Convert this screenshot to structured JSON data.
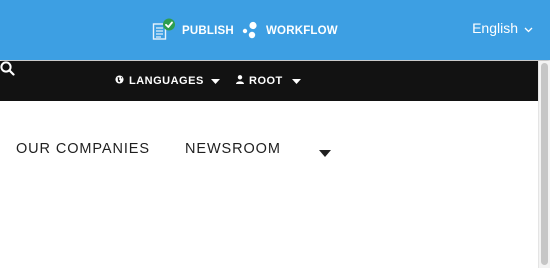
{
  "topbar": {
    "publish_label": "PUBLISH",
    "workflow_label": "WORKFLOW",
    "language_label": "English",
    "icons": {
      "publish": "document-check-icon",
      "workflow": "workflow-dots-icon",
      "language": "chevron-down-icon"
    }
  },
  "navbar": {
    "languages_label": "LANGUAGES",
    "root_label": "ROOT",
    "icons": {
      "languages": "globe-icon",
      "root": "user-icon",
      "caret": "caret-down-icon",
      "search": "search-icon"
    }
  },
  "menu": {
    "items": [
      {
        "label": "OUR COMPANIES"
      },
      {
        "label": "NEWSROOM"
      }
    ],
    "more_icon": "caret-down-icon"
  },
  "colors": {
    "topbar_bg": "#3d9fe3",
    "navbar_bg": "#121212",
    "check_green": "#2e9e4f",
    "text_dark": "#1f1f1f"
  }
}
